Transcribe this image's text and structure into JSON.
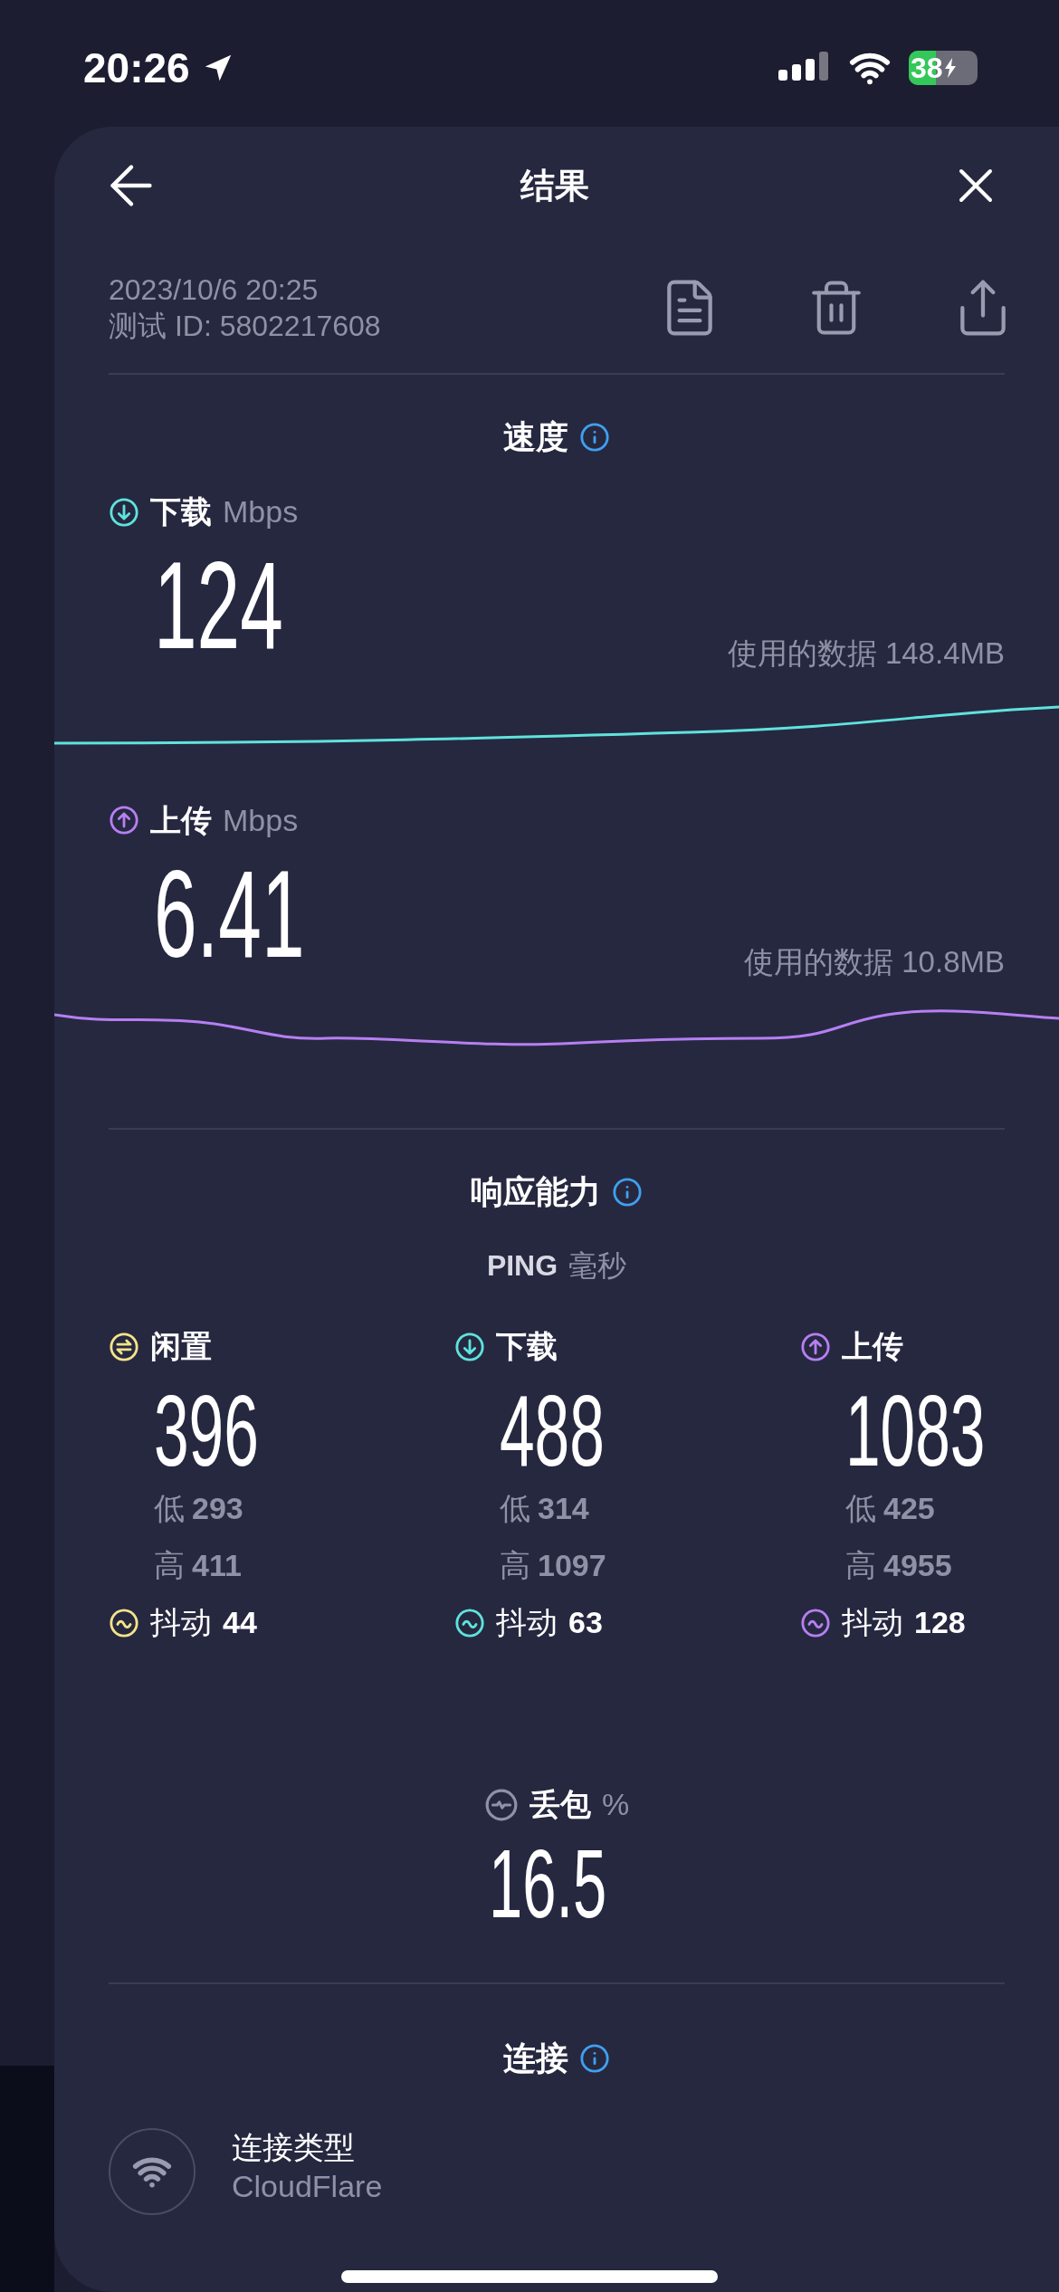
{
  "status_bar": {
    "time": "20:26",
    "battery": "38"
  },
  "header": {
    "title": "结果"
  },
  "test_info": {
    "date": "2023/10/6 20:25",
    "test_id": "测试 ID: 5802217608"
  },
  "speed": {
    "title": "速度",
    "results": [
      {
        "kind": "download",
        "label": "下载",
        "unit": "Mbps",
        "value": "124",
        "data_used": "使用的数据 148.4MB"
      },
      {
        "kind": "upload",
        "label": "上传",
        "unit": "Mbps",
        "value": "6.41",
        "data_used": "使用的数据 10.8MB"
      }
    ]
  },
  "responsiveness": {
    "title": "响应能力",
    "ping_label": "PING",
    "ping_unit": "毫秒",
    "columns": [
      {
        "kind": "idle",
        "label": "闲置",
        "value": "396",
        "low_label": "低",
        "low": "293",
        "high_label": "高",
        "high": "411",
        "jitter_label": "抖动",
        "jitter": "44"
      },
      {
        "kind": "download",
        "label": "下载",
        "value": "488",
        "low_label": "低",
        "low": "314",
        "high_label": "高",
        "high": "1097",
        "jitter_label": "抖动",
        "jitter": "63"
      },
      {
        "kind": "upload",
        "label": "上传",
        "value": "1083",
        "low_label": "低",
        "low": "425",
        "high_label": "高",
        "high": "4955",
        "jitter_label": "抖动",
        "jitter": "128"
      }
    ]
  },
  "packet_loss": {
    "label": "丢包",
    "unit": "%",
    "value": "16.5"
  },
  "connection": {
    "title": "连接",
    "items": [
      {
        "label": "连接类型",
        "value": "CloudFlare"
      }
    ]
  }
}
